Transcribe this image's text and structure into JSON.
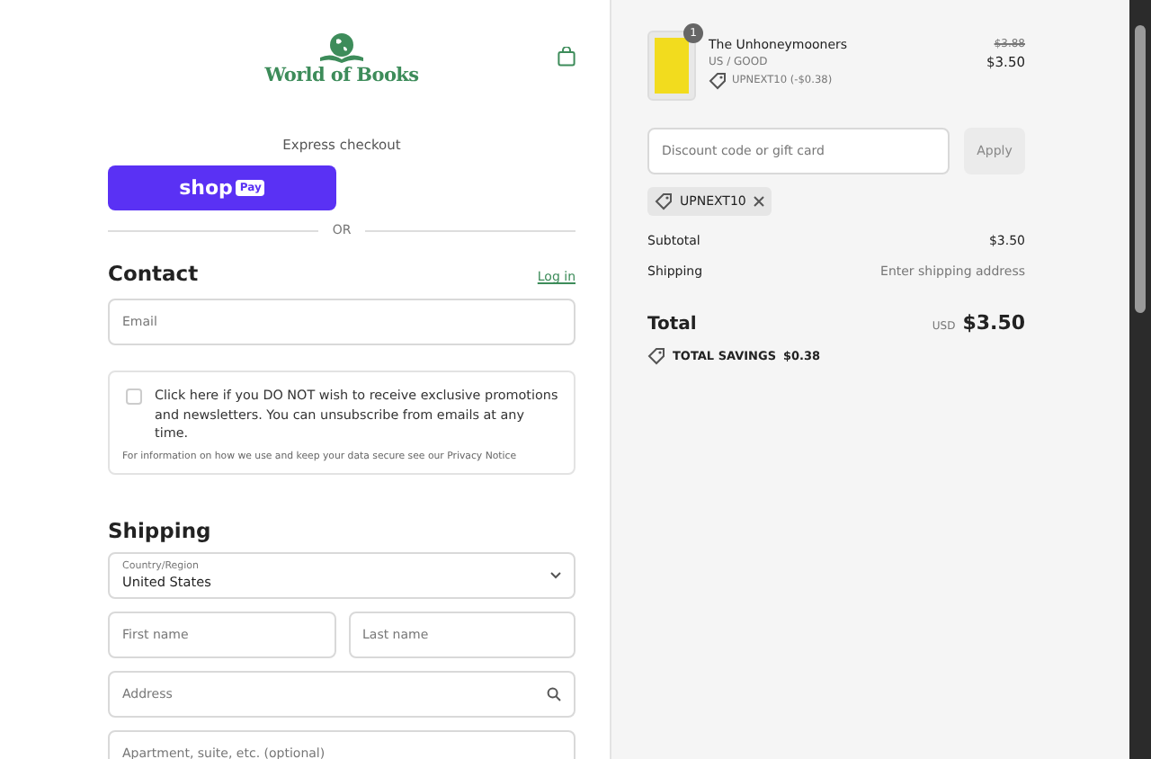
{
  "header": {
    "logo": "World of Books"
  },
  "express": {
    "label": "Express checkout",
    "shop_button": {
      "word": "shop",
      "badge": "Pay"
    },
    "divider": "OR"
  },
  "contact": {
    "title": "Contact",
    "login_link": "Log in",
    "email": {
      "placeholder": "Email"
    },
    "opt_out": {
      "checked": false,
      "label": "Click here if you DO NOT wish to receive exclusive promotions and newsletters. You can unsubscribe from emails at any time.",
      "note": "For information on how we use and keep your data secure see our Privacy Notice"
    }
  },
  "shipping": {
    "title": "Shipping",
    "country": {
      "label": "Country/Region",
      "value": "United States"
    },
    "fields": [
      {
        "kind": "half",
        "placeholder": "First name"
      },
      {
        "kind": "half",
        "placeholder": "Last name"
      },
      {
        "kind": "search",
        "placeholder": "Address"
      },
      {
        "kind": "full",
        "placeholder": "Apartment, suite, etc. (optional)"
      }
    ]
  },
  "summary": {
    "item": {
      "quantity": "1",
      "title": "The Unhoneymooners",
      "variant": "US / GOOD",
      "discount": "UPNEXT10 (-$0.38)",
      "original_price": "$3.88",
      "price": "$3.50"
    },
    "discount_field": {
      "placeholder": "Discount code or gift card"
    },
    "apply_button": "Apply",
    "applied_code": "UPNEXT10",
    "lines": [
      {
        "label": "Subtotal",
        "value": "$3.50"
      },
      {
        "label": "Shipping",
        "value": "Enter shipping address"
      }
    ],
    "total": {
      "label": "Total",
      "currency": "USD",
      "value": "$3.50"
    },
    "savings": {
      "label": "TOTAL SAVINGS",
      "value": "$0.38"
    }
  }
}
